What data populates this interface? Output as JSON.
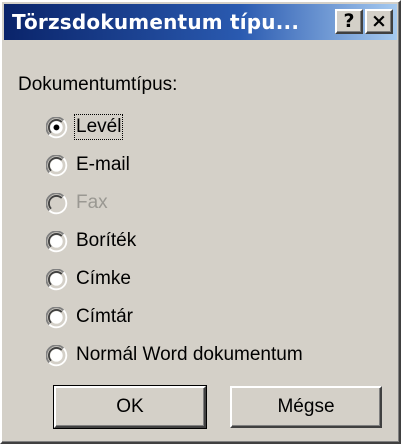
{
  "titlebar": {
    "title": "Törzsdokumentum típu...",
    "help_glyph": "?",
    "close_glyph": "×"
  },
  "group": {
    "label": "Dokumentumtípus:"
  },
  "options": [
    {
      "label": "Levél",
      "selected": true,
      "disabled": false
    },
    {
      "label": "E-mail",
      "selected": false,
      "disabled": false
    },
    {
      "label": "Fax",
      "selected": false,
      "disabled": true
    },
    {
      "label": "Boríték",
      "selected": false,
      "disabled": false
    },
    {
      "label": "Címke",
      "selected": false,
      "disabled": false
    },
    {
      "label": "Címtár",
      "selected": false,
      "disabled": false
    },
    {
      "label": "Normál Word dokumentum",
      "selected": false,
      "disabled": false
    }
  ],
  "buttons": {
    "ok_label": "OK",
    "cancel_label": "Mégse"
  },
  "colors": {
    "face": "#d4d0c8",
    "title_start": "#0a246a",
    "title_end": "#a6caf0",
    "disabled_text": "#9a9892"
  }
}
